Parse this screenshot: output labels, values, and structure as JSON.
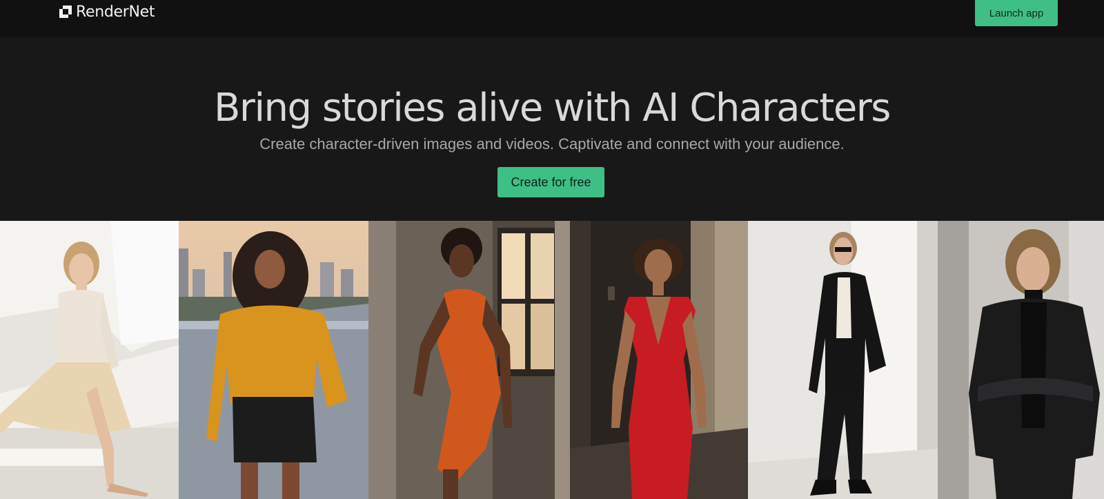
{
  "header": {
    "brand": "RenderNet",
    "launch_label": "Launch app",
    "logo_icon": "rendernet-logo-icon"
  },
  "hero": {
    "title": "Bring stories alive with AI Characters",
    "subtitle": "Create character-driven images and videos. Captivate and connect with your audience.",
    "cta_label": "Create for free"
  },
  "colors": {
    "accent": "#3fbf85",
    "page_bg": "#171717",
    "header_bg": "#111111",
    "title_text": "#d9d9d9",
    "subtitle_text": "#a8a8a8"
  },
  "gallery": {
    "photos": [
      {
        "subject": "woman in cream knit top and skirt sitting on white bench"
      },
      {
        "subject": "woman in mustard sweater and black leather skirt on rooftop at sunset"
      },
      {
        "subject": "woman in orange halter knit dress by window"
      },
      {
        "subject": "woman in red v-neck dress in dark corridor"
      },
      {
        "subject": "woman in black suit and sunglasses leaning on white wall"
      },
      {
        "subject": "woman in black leather jacket leaning on concrete pillar"
      }
    ]
  }
}
